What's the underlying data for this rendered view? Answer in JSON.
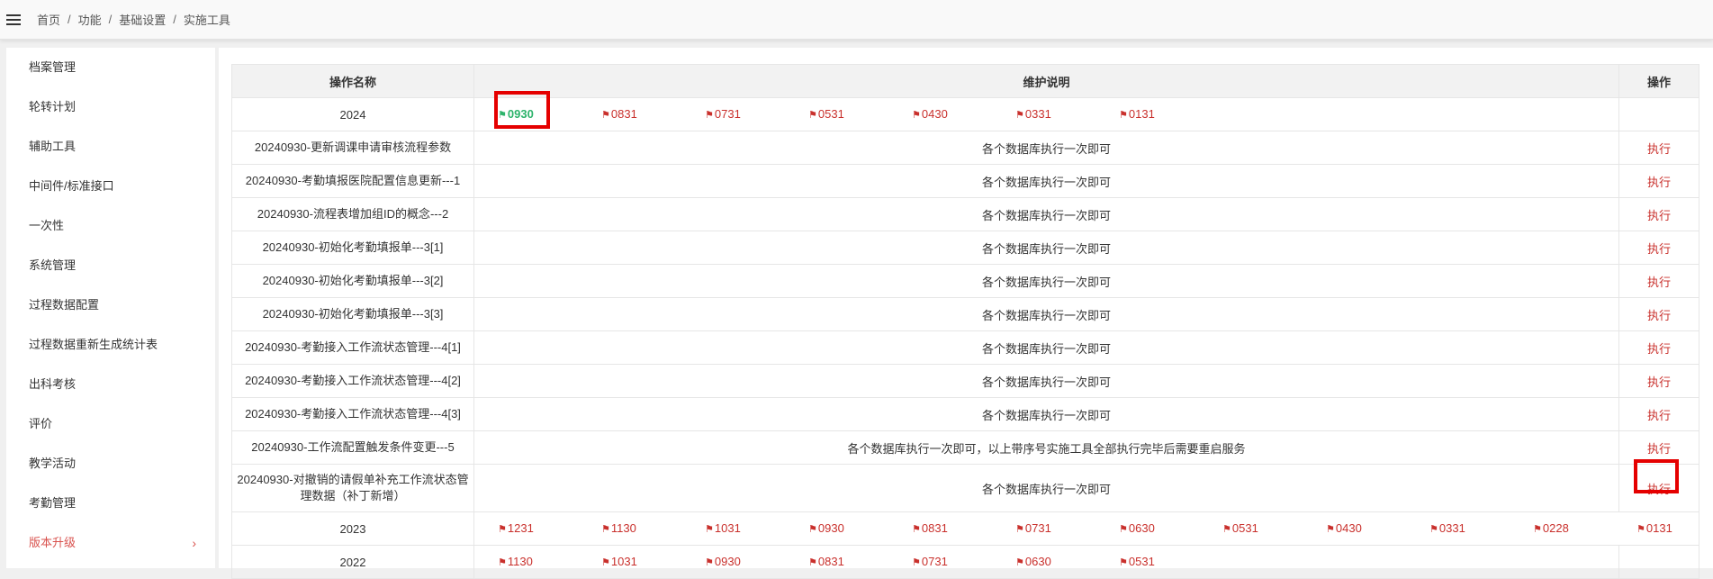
{
  "breadcrumb": [
    "首页",
    "功能",
    "基础设置",
    "实施工具"
  ],
  "breadcrumb_sep": "/",
  "sidebar": {
    "items": [
      {
        "label": "档案管理"
      },
      {
        "label": "轮转计划"
      },
      {
        "label": "辅助工具"
      },
      {
        "label": "中间件/标准接口"
      },
      {
        "label": "一次性"
      },
      {
        "label": "系统管理"
      },
      {
        "label": "过程数据配置"
      },
      {
        "label": "过程数据重新生成统计表"
      },
      {
        "label": "出科考核"
      },
      {
        "label": "评价"
      },
      {
        "label": "教学活动"
      },
      {
        "label": "考勤管理"
      },
      {
        "label": "版本升级",
        "chevron": "›"
      }
    ]
  },
  "table": {
    "headers": {
      "name": "操作名称",
      "desc": "维护说明",
      "op": "操作"
    },
    "exec_label": "执行",
    "flag_icon": "flag-icon",
    "year_2024": {
      "year": "2024",
      "flags": [
        "0930",
        "0831",
        "0731",
        "0531",
        "0430",
        "0331",
        "0131"
      ],
      "selected": "0930"
    },
    "rows": [
      {
        "name": "20240930-更新调课申请审核流程参数",
        "desc": "各个数据库执行一次即可"
      },
      {
        "name": "20240930-考勤填报医院配置信息更新---1",
        "desc": "各个数据库执行一次即可"
      },
      {
        "name": "20240930-流程表增加组ID的概念---2",
        "desc": "各个数据库执行一次即可"
      },
      {
        "name": "20240930-初始化考勤填报单---3[1]",
        "desc": "各个数据库执行一次即可"
      },
      {
        "name": "20240930-初始化考勤填报单---3[2]",
        "desc": "各个数据库执行一次即可"
      },
      {
        "name": "20240930-初始化考勤填报单---3[3]",
        "desc": "各个数据库执行一次即可"
      },
      {
        "name": "20240930-考勤接入工作流状态管理---4[1]",
        "desc": "各个数据库执行一次即可"
      },
      {
        "name": "20240930-考勤接入工作流状态管理---4[2]",
        "desc": "各个数据库执行一次即可"
      },
      {
        "name": "20240930-考勤接入工作流状态管理---4[3]",
        "desc": "各个数据库执行一次即可"
      },
      {
        "name": "20240930-工作流配置触发条件变更---5",
        "desc": "各个数据库执行一次即可，以上带序号实施工具全部执行完毕后需要重启服务"
      },
      {
        "name": "20240930-对撤销的请假单补充工作流状态管理数据（补丁新增）",
        "desc": "各个数据库执行一次即可"
      }
    ],
    "year_2023": {
      "year": "2023",
      "flags": [
        "1231",
        "1130",
        "1031",
        "0930",
        "0831",
        "0731",
        "0630",
        "0531",
        "0430",
        "0331",
        "0228",
        "0131"
      ]
    },
    "year_2022": {
      "year": "2022",
      "flags": [
        "1130",
        "1031",
        "0930",
        "0831",
        "0731",
        "0630",
        "0531"
      ]
    }
  },
  "colors": {
    "accent": "#c9302c",
    "selected": "#2db36b",
    "highlight": "#e50000"
  }
}
